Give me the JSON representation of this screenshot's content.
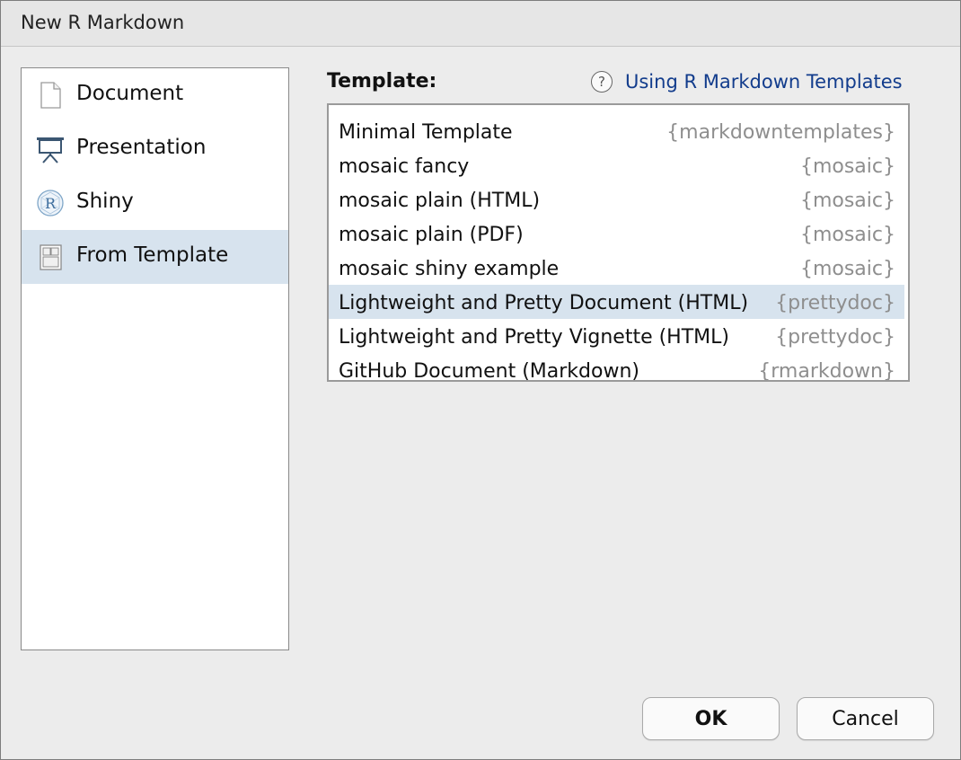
{
  "window": {
    "title": "New R Markdown"
  },
  "types": [
    {
      "label": "Document",
      "icon": "document-icon",
      "selected": false
    },
    {
      "label": "Presentation",
      "icon": "presentation-icon",
      "selected": false
    },
    {
      "label": "Shiny",
      "icon": "shiny-r-icon",
      "selected": false
    },
    {
      "label": "From Template",
      "icon": "template-icon",
      "selected": true
    }
  ],
  "template": {
    "label": "Template:",
    "help_link": "Using R Markdown Templates",
    "help_icon": "question-circle-icon",
    "items": [
      {
        "name": "Minimal Template",
        "package": "{markdowntemplates}"
      },
      {
        "name": "mosaic fancy",
        "package": "{mosaic}"
      },
      {
        "name": "mosaic plain (HTML)",
        "package": "{mosaic}"
      },
      {
        "name": "mosaic plain (PDF)",
        "package": "{mosaic}"
      },
      {
        "name": "mosaic shiny example",
        "package": "{mosaic}"
      },
      {
        "name": "Lightweight and Pretty Document (HTML)",
        "package": "{prettydoc}"
      },
      {
        "name": "Lightweight and Pretty Vignette (HTML)",
        "package": "{prettydoc}"
      },
      {
        "name": "GitHub Document (Markdown)",
        "package": "{rmarkdown}"
      }
    ],
    "selected_index": 5
  },
  "buttons": {
    "ok": "OK",
    "cancel": "Cancel"
  },
  "colors": {
    "selection": "#d7e3ee",
    "link": "#123c8c",
    "package_text": "#8e8e8e"
  }
}
